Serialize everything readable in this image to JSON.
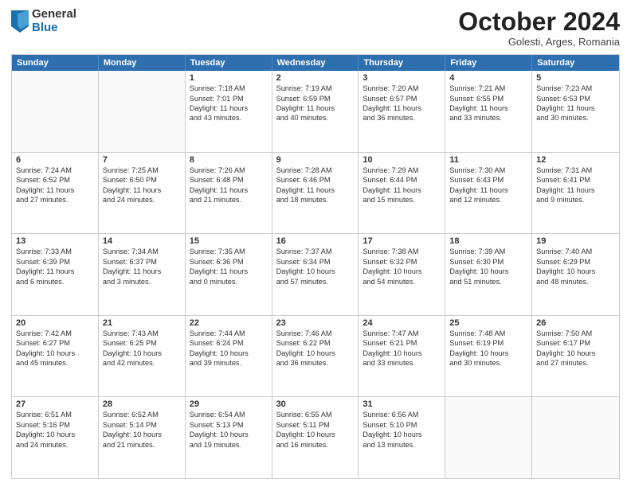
{
  "header": {
    "logo_general": "General",
    "logo_blue": "Blue",
    "month_title": "October 2024",
    "location": "Golesti, Arges, Romania"
  },
  "days_of_week": [
    "Sunday",
    "Monday",
    "Tuesday",
    "Wednesday",
    "Thursday",
    "Friday",
    "Saturday"
  ],
  "rows": [
    [
      {
        "day": "",
        "lines": [],
        "empty": true
      },
      {
        "day": "",
        "lines": [],
        "empty": true
      },
      {
        "day": "1",
        "lines": [
          "Sunrise: 7:18 AM",
          "Sunset: 7:01 PM",
          "Daylight: 11 hours",
          "and 43 minutes."
        ],
        "empty": false
      },
      {
        "day": "2",
        "lines": [
          "Sunrise: 7:19 AM",
          "Sunset: 6:59 PM",
          "Daylight: 11 hours",
          "and 40 minutes."
        ],
        "empty": false
      },
      {
        "day": "3",
        "lines": [
          "Sunrise: 7:20 AM",
          "Sunset: 6:57 PM",
          "Daylight: 11 hours",
          "and 36 minutes."
        ],
        "empty": false
      },
      {
        "day": "4",
        "lines": [
          "Sunrise: 7:21 AM",
          "Sunset: 6:55 PM",
          "Daylight: 11 hours",
          "and 33 minutes."
        ],
        "empty": false
      },
      {
        "day": "5",
        "lines": [
          "Sunrise: 7:23 AM",
          "Sunset: 6:53 PM",
          "Daylight: 11 hours",
          "and 30 minutes."
        ],
        "empty": false
      }
    ],
    [
      {
        "day": "6",
        "lines": [
          "Sunrise: 7:24 AM",
          "Sunset: 6:52 PM",
          "Daylight: 11 hours",
          "and 27 minutes."
        ],
        "empty": false
      },
      {
        "day": "7",
        "lines": [
          "Sunrise: 7:25 AM",
          "Sunset: 6:50 PM",
          "Daylight: 11 hours",
          "and 24 minutes."
        ],
        "empty": false
      },
      {
        "day": "8",
        "lines": [
          "Sunrise: 7:26 AM",
          "Sunset: 6:48 PM",
          "Daylight: 11 hours",
          "and 21 minutes."
        ],
        "empty": false
      },
      {
        "day": "9",
        "lines": [
          "Sunrise: 7:28 AM",
          "Sunset: 6:46 PM",
          "Daylight: 11 hours",
          "and 18 minutes."
        ],
        "empty": false
      },
      {
        "day": "10",
        "lines": [
          "Sunrise: 7:29 AM",
          "Sunset: 6:44 PM",
          "Daylight: 11 hours",
          "and 15 minutes."
        ],
        "empty": false
      },
      {
        "day": "11",
        "lines": [
          "Sunrise: 7:30 AM",
          "Sunset: 6:43 PM",
          "Daylight: 11 hours",
          "and 12 minutes."
        ],
        "empty": false
      },
      {
        "day": "12",
        "lines": [
          "Sunrise: 7:31 AM",
          "Sunset: 6:41 PM",
          "Daylight: 11 hours",
          "and 9 minutes."
        ],
        "empty": false
      }
    ],
    [
      {
        "day": "13",
        "lines": [
          "Sunrise: 7:33 AM",
          "Sunset: 6:39 PM",
          "Daylight: 11 hours",
          "and 6 minutes."
        ],
        "empty": false
      },
      {
        "day": "14",
        "lines": [
          "Sunrise: 7:34 AM",
          "Sunset: 6:37 PM",
          "Daylight: 11 hours",
          "and 3 minutes."
        ],
        "empty": false
      },
      {
        "day": "15",
        "lines": [
          "Sunrise: 7:35 AM",
          "Sunset: 6:36 PM",
          "Daylight: 11 hours",
          "and 0 minutes."
        ],
        "empty": false
      },
      {
        "day": "16",
        "lines": [
          "Sunrise: 7:37 AM",
          "Sunset: 6:34 PM",
          "Daylight: 10 hours",
          "and 57 minutes."
        ],
        "empty": false
      },
      {
        "day": "17",
        "lines": [
          "Sunrise: 7:38 AM",
          "Sunset: 6:32 PM",
          "Daylight: 10 hours",
          "and 54 minutes."
        ],
        "empty": false
      },
      {
        "day": "18",
        "lines": [
          "Sunrise: 7:39 AM",
          "Sunset: 6:30 PM",
          "Daylight: 10 hours",
          "and 51 minutes."
        ],
        "empty": false
      },
      {
        "day": "19",
        "lines": [
          "Sunrise: 7:40 AM",
          "Sunset: 6:29 PM",
          "Daylight: 10 hours",
          "and 48 minutes."
        ],
        "empty": false
      }
    ],
    [
      {
        "day": "20",
        "lines": [
          "Sunrise: 7:42 AM",
          "Sunset: 6:27 PM",
          "Daylight: 10 hours",
          "and 45 minutes."
        ],
        "empty": false
      },
      {
        "day": "21",
        "lines": [
          "Sunrise: 7:43 AM",
          "Sunset: 6:25 PM",
          "Daylight: 10 hours",
          "and 42 minutes."
        ],
        "empty": false
      },
      {
        "day": "22",
        "lines": [
          "Sunrise: 7:44 AM",
          "Sunset: 6:24 PM",
          "Daylight: 10 hours",
          "and 39 minutes."
        ],
        "empty": false
      },
      {
        "day": "23",
        "lines": [
          "Sunrise: 7:46 AM",
          "Sunset: 6:22 PM",
          "Daylight: 10 hours",
          "and 36 minutes."
        ],
        "empty": false
      },
      {
        "day": "24",
        "lines": [
          "Sunrise: 7:47 AM",
          "Sunset: 6:21 PM",
          "Daylight: 10 hours",
          "and 33 minutes."
        ],
        "empty": false
      },
      {
        "day": "25",
        "lines": [
          "Sunrise: 7:48 AM",
          "Sunset: 6:19 PM",
          "Daylight: 10 hours",
          "and 30 minutes."
        ],
        "empty": false
      },
      {
        "day": "26",
        "lines": [
          "Sunrise: 7:50 AM",
          "Sunset: 6:17 PM",
          "Daylight: 10 hours",
          "and 27 minutes."
        ],
        "empty": false
      }
    ],
    [
      {
        "day": "27",
        "lines": [
          "Sunrise: 6:51 AM",
          "Sunset: 5:16 PM",
          "Daylight: 10 hours",
          "and 24 minutes."
        ],
        "empty": false
      },
      {
        "day": "28",
        "lines": [
          "Sunrise: 6:52 AM",
          "Sunset: 5:14 PM",
          "Daylight: 10 hours",
          "and 21 minutes."
        ],
        "empty": false
      },
      {
        "day": "29",
        "lines": [
          "Sunrise: 6:54 AM",
          "Sunset: 5:13 PM",
          "Daylight: 10 hours",
          "and 19 minutes."
        ],
        "empty": false
      },
      {
        "day": "30",
        "lines": [
          "Sunrise: 6:55 AM",
          "Sunset: 5:11 PM",
          "Daylight: 10 hours",
          "and 16 minutes."
        ],
        "empty": false
      },
      {
        "day": "31",
        "lines": [
          "Sunrise: 6:56 AM",
          "Sunset: 5:10 PM",
          "Daylight: 10 hours",
          "and 13 minutes."
        ],
        "empty": false
      },
      {
        "day": "",
        "lines": [],
        "empty": true
      },
      {
        "day": "",
        "lines": [],
        "empty": true
      }
    ]
  ]
}
